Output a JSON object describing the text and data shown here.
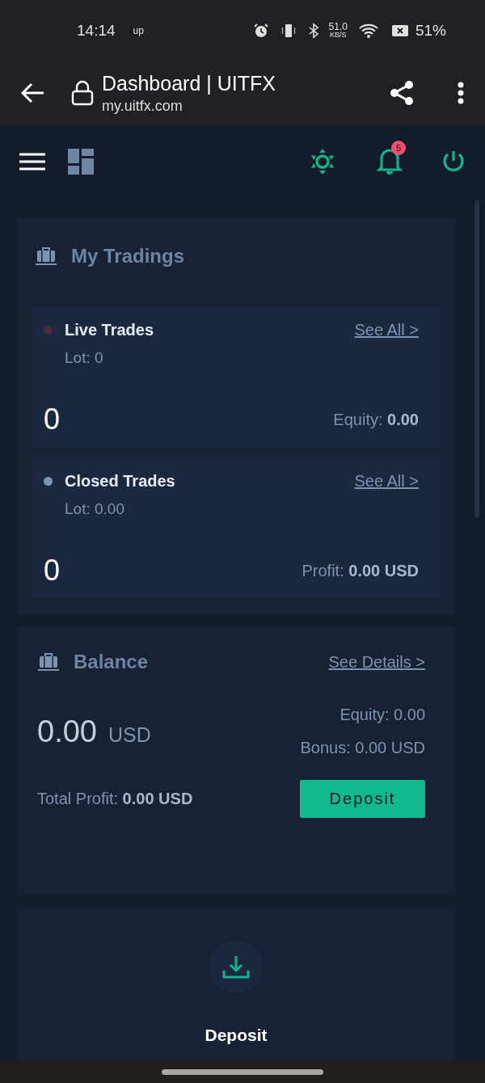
{
  "status_bar": {
    "time": "14:14",
    "indicator": "up",
    "speed": "51.0",
    "speed_unit": "KB/S",
    "battery": "51%"
  },
  "browser": {
    "title": "Dashboard | UITFX",
    "url": "my.uitfx.com"
  },
  "header": {
    "notification_count": "5"
  },
  "my_tradings": {
    "title": "My Tradings",
    "trades": [
      {
        "title": "Live Trades",
        "color": "#4a2b3c",
        "link": "See All >",
        "lot": "Lot: 0",
        "count": "0",
        "summary": "Equity: **0.00**"
      },
      {
        "title": "Closed Trades",
        "color": "#7d93b0",
        "link": "See All >",
        "lot": "Lot: 0.00",
        "count": "0",
        "summary": "Profit: **0.00 USD**"
      }
    ]
  },
  "balance": {
    "title": "Balance",
    "link": "See Details >",
    "amount": "0.00",
    "currency": "USD",
    "equity": "Equity: 0.00",
    "bonus": "Bonus: 0.00 USD",
    "total_profit": "Total Profit: **0.00 USD**",
    "button": "Deposit"
  },
  "action": {
    "label": "Deposit"
  }
}
